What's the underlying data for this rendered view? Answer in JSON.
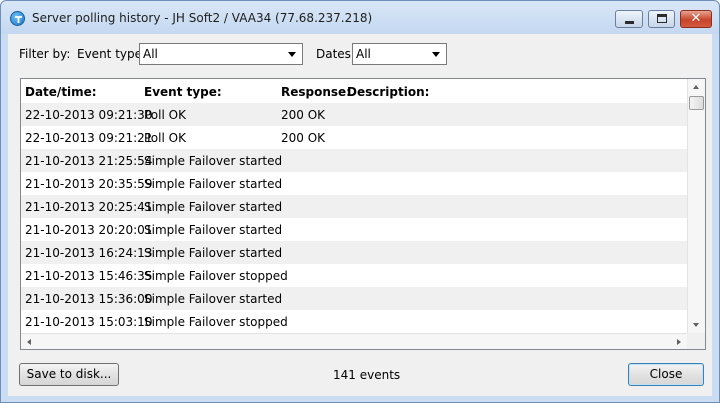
{
  "window": {
    "title": "Server polling history - JH Soft2 / VAA34 (77.68.237.218)",
    "icon": "app-globe-icon",
    "controls": [
      "minimize",
      "maximize",
      "close"
    ]
  },
  "filter": {
    "label": "Filter by:",
    "event_type_label": "Event type:",
    "event_type_value": "All",
    "dates_label": "Dates:",
    "dates_value": "All"
  },
  "table": {
    "columns": [
      "Date/time:",
      "Event type:",
      "Response:",
      "Description:"
    ],
    "rows": [
      {
        "datetime": "22-10-2013 09:21:30",
        "event": "Poll OK",
        "response": "200 OK",
        "description": ""
      },
      {
        "datetime": "22-10-2013 09:21:21",
        "event": "Poll OK",
        "response": "200 OK",
        "description": ""
      },
      {
        "datetime": "21-10-2013 21:25:54",
        "event": "Simple Failover started",
        "response": "",
        "description": ""
      },
      {
        "datetime": "21-10-2013 20:35:59",
        "event": "Simple Failover started",
        "response": "",
        "description": ""
      },
      {
        "datetime": "21-10-2013 20:25:41",
        "event": "Simple Failover started",
        "response": "",
        "description": ""
      },
      {
        "datetime": "21-10-2013 20:20:01",
        "event": "Simple Failover started",
        "response": "",
        "description": ""
      },
      {
        "datetime": "21-10-2013 16:24:13",
        "event": "Simple Failover started",
        "response": "",
        "description": ""
      },
      {
        "datetime": "21-10-2013 15:46:35",
        "event": "Simple Failover stopped",
        "response": "",
        "description": ""
      },
      {
        "datetime": "21-10-2013 15:36:00",
        "event": "Simple Failover started",
        "response": "",
        "description": ""
      },
      {
        "datetime": "21-10-2013 15:03:10",
        "event": "Simple Failover stopped",
        "response": "",
        "description": ""
      }
    ]
  },
  "footer": {
    "save_label": "Save to disk...",
    "events_count": "141 events",
    "close_label": "Close"
  },
  "colors": {
    "title_bar": "#c4d8f0",
    "close_button": "#c7442b",
    "row_alt": "#f0f0f0"
  }
}
